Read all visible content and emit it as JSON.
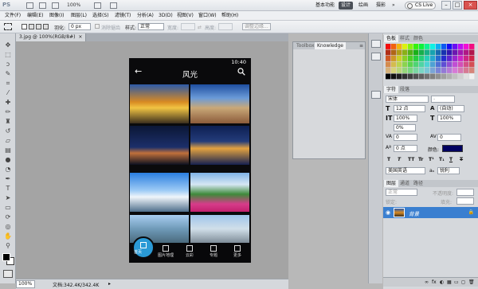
{
  "titlebar": {
    "logo": "PS",
    "zoom": "100%",
    "workspaces": [
      "基本功能",
      "设计",
      "绘画",
      "摄影"
    ],
    "active_workspace": "设计",
    "more": "»",
    "cslive": "CS Live"
  },
  "menu": [
    "文件(F)",
    "编辑(E)",
    "图像(I)",
    "图层(L)",
    "选择(S)",
    "滤镜(T)",
    "分析(A)",
    "3D(D)",
    "视图(V)",
    "窗口(W)",
    "帮助(H)"
  ],
  "options": {
    "feather_label": "羽化:",
    "feather_value": "0 px",
    "antialias": "消除锯齿",
    "style_label": "样式:",
    "style_value": "正常",
    "width_label": "宽度:",
    "height_label": "高度:",
    "refine": "调整边缘..."
  },
  "document": {
    "tab": "3.jpg @ 100%(RGB/8#)",
    "close": "×"
  },
  "phone": {
    "time": "10:40",
    "back": "←",
    "title": "风光",
    "nav": [
      {
        "label": "首页"
      },
      {
        "label": "图片地理"
      },
      {
        "label": "云彩"
      },
      {
        "label": "专题"
      },
      {
        "label": "更多"
      }
    ]
  },
  "float_panel": {
    "tabs": [
      "Toolbox",
      "Knowledge"
    ],
    "active": "Knowledge"
  },
  "panels": {
    "swatches_tabs": [
      "色板",
      "样式",
      "颜色"
    ],
    "char_tabs": [
      "字符",
      "段落"
    ],
    "font_family": "宋体",
    "font_style": "-",
    "font_size": "12 点",
    "leading": "(自动)",
    "vscale": "100%",
    "hscale": "100%",
    "tracking_a": "0%",
    "kerning": "0",
    "tracking": "0",
    "baseline": "0 点",
    "color_label": "颜色:",
    "type_btns": [
      "T",
      "T",
      "TT",
      "Tr",
      "T¹",
      "T₁",
      "T",
      "T"
    ],
    "language": "美国英语",
    "aa_label": "aₐ",
    "aa_value": "锐利",
    "layers_tabs": [
      "图层",
      "通道",
      "路径"
    ],
    "blend_mode": "正常",
    "opacity_label": "不透明度:",
    "lock_label": "锁定:",
    "fill_label": "填充:",
    "layer_name": "背景",
    "fx_icons": [
      "∞",
      "fx",
      "◐",
      "▦",
      "▭",
      "◻",
      "🗑"
    ]
  },
  "status": {
    "zoom": "100%",
    "doc": "文档:342.4K/342.4K"
  },
  "colors": {
    "accent": "#2a9ad6",
    "layer_selected": "#3a7fd0",
    "foreground": "#000000",
    "background": "#ffffff"
  }
}
